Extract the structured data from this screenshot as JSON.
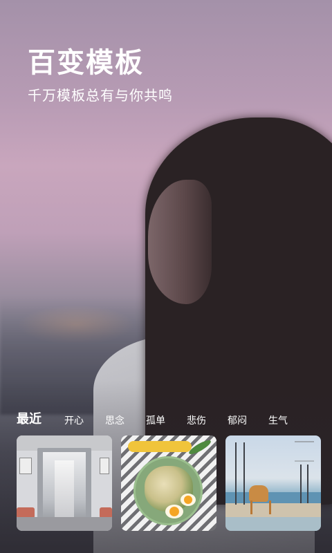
{
  "header": {
    "title": "百变模板",
    "subtitle": "千万模板总有与你共鸣"
  },
  "categories": {
    "active": "最近",
    "items": [
      "最近",
      "开心",
      "思念",
      "孤单",
      "悲伤",
      "郁闷",
      "生气"
    ]
  },
  "thumbnails": [
    {
      "kind": "subway"
    },
    {
      "kind": "food"
    },
    {
      "kind": "seaside"
    }
  ],
  "colors": {
    "text": "#ffffff",
    "sky_top": "#a491a9",
    "sky_mid": "#c9a6bd"
  }
}
